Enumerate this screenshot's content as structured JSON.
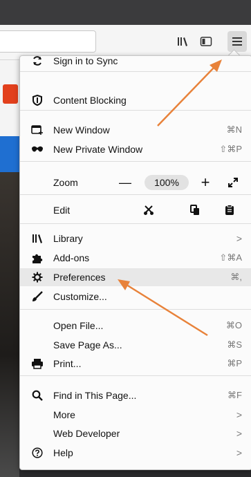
{
  "menu": {
    "sign_in": "Sign in to Sync",
    "content_blocking": "Content Blocking",
    "new_window": {
      "label": "New Window",
      "shortcut": "⌘N"
    },
    "new_private_window": {
      "label": "New Private Window",
      "shortcut": "⇧⌘P"
    },
    "zoom": {
      "label": "Zoom",
      "minus": "—",
      "value": "100%",
      "plus": "+",
      "fullscreen": "⤢"
    },
    "edit": {
      "label": "Edit"
    },
    "library": {
      "label": "Library",
      "submenu": ">"
    },
    "addons": {
      "label": "Add-ons",
      "shortcut": "⇧⌘A"
    },
    "preferences": {
      "label": "Preferences",
      "shortcut": "⌘,"
    },
    "customize": {
      "label": "Customize..."
    },
    "open_file": {
      "label": "Open File...",
      "shortcut": "⌘O"
    },
    "save_page": {
      "label": "Save Page As...",
      "shortcut": "⌘S"
    },
    "print": {
      "label": "Print...",
      "shortcut": "⌘P"
    },
    "find": {
      "label": "Find in This Page...",
      "shortcut": "⌘F"
    },
    "more": {
      "label": "More",
      "submenu": ">"
    },
    "web_developer": {
      "label": "Web Developer",
      "submenu": ">"
    },
    "help": {
      "label": "Help",
      "submenu": ">"
    }
  },
  "colors": {
    "annotation_arrow": "#e8823a",
    "highlight_row": "#e8e8e8"
  }
}
